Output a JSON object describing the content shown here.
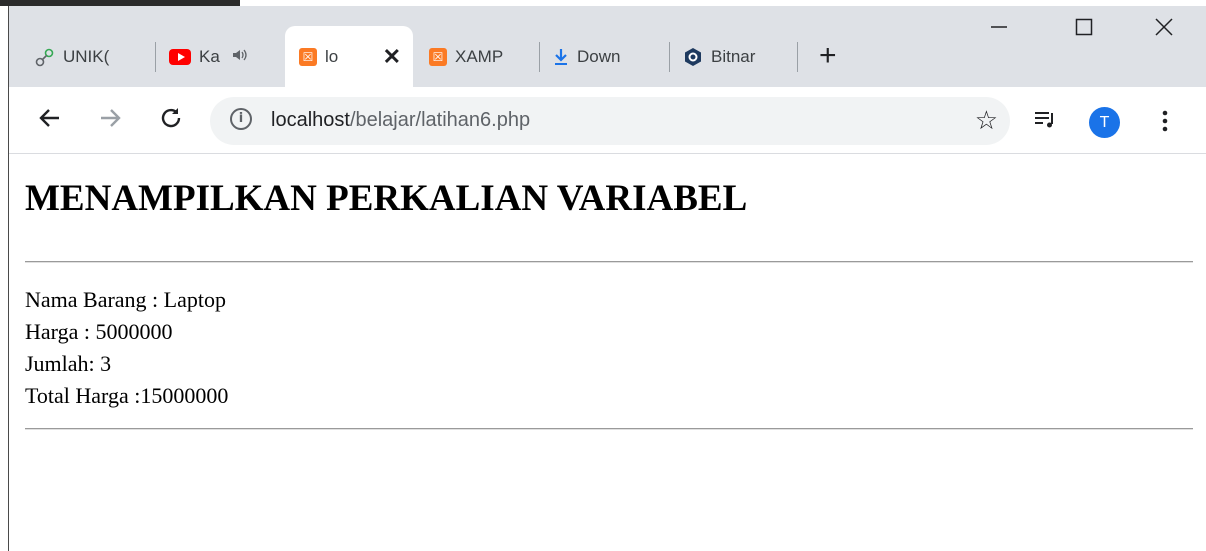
{
  "browser": {
    "tabs": [
      {
        "label": "UNIK(",
        "icon": "link-icon"
      },
      {
        "label": "Ka",
        "icon": "youtube-icon",
        "audio": "speaker-icon"
      },
      {
        "label": "lo",
        "icon": "xampp-icon",
        "active": true
      },
      {
        "label": "XAMP",
        "icon": "xampp-icon"
      },
      {
        "label": "Down",
        "icon": "download-icon"
      },
      {
        "label": "Bitnar",
        "icon": "bitnami-icon"
      }
    ],
    "url_host": "localhost",
    "url_path": "/belajar/latihan6.php",
    "avatar_initial": "T"
  },
  "page": {
    "heading": "MENAMPILKAN PERKALIAN VARIABEL",
    "lines": [
      "Nama Barang : Laptop",
      "Harga : 5000000",
      "Jumlah: 3",
      "Total Harga :15000000"
    ]
  },
  "colors": {
    "tabstrip_bg": "#dee1e6",
    "omnibox_bg": "#f1f3f4",
    "avatar_bg": "#1a73e8",
    "xampp_orange": "#fb7a24",
    "youtube_red": "#ff0000"
  }
}
